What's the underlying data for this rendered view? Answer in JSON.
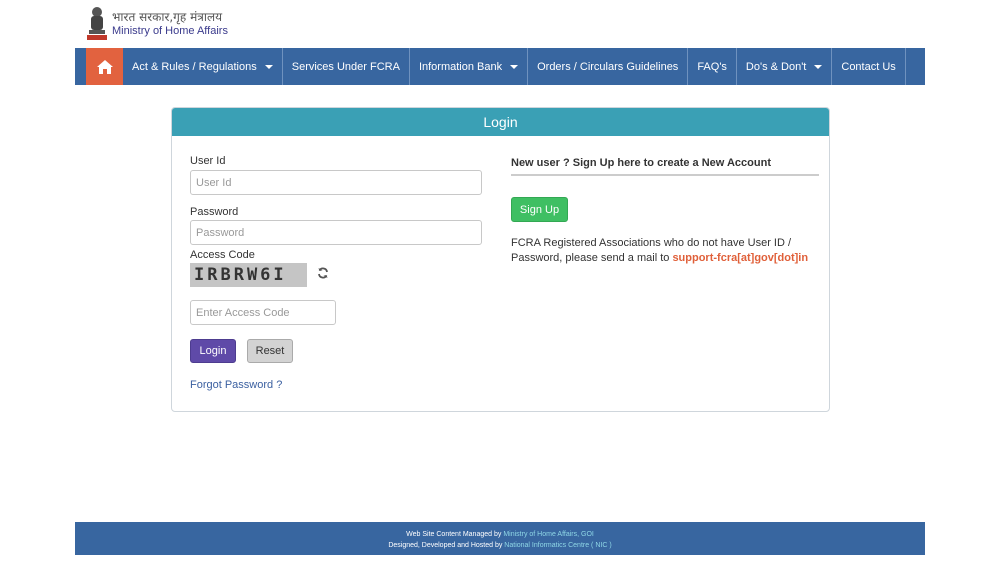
{
  "header": {
    "hindi": "भारत सरकार,गृह मंत्रालय",
    "english": "Ministry of Home Affairs"
  },
  "nav": {
    "items": [
      {
        "label": "Act & Rules / Regulations",
        "dropdown": true
      },
      {
        "label": "Services Under FCRA",
        "dropdown": false
      },
      {
        "label": "Information Bank",
        "dropdown": true
      },
      {
        "label": "Orders / Circulars Guidelines",
        "dropdown": false
      },
      {
        "label": "FAQ's",
        "dropdown": false
      },
      {
        "label": "Do's & Don't",
        "dropdown": true
      },
      {
        "label": "Contact Us",
        "dropdown": false
      }
    ]
  },
  "login": {
    "title": "Login",
    "user_id_label": "User Id",
    "user_id_placeholder": "User Id",
    "password_label": "Password",
    "password_placeholder": "Password",
    "access_code_label": "Access Code",
    "captcha_text": "IRBRW6I",
    "access_code_placeholder": "Enter Access Code",
    "login_button": "Login",
    "reset_button": "Reset",
    "forgot_password": "Forgot Password ?"
  },
  "signup": {
    "heading": "New user ? Sign Up here to create a New Account",
    "button": "Sign Up",
    "note": "FCRA Registered Associations who do not have User ID / Password, please send a mail to",
    "email": "support-fcra[at]gov[dot]in"
  },
  "footer": {
    "line1_prefix": "Web Site Content Managed by",
    "line1_link": "Ministry of Home Affairs, GOI",
    "line2_prefix": "Designed, Developed and Hosted by",
    "line2_link": "National Informatics Centre ( NIC )"
  },
  "colors": {
    "nav_bg": "#3866a0",
    "home_bg": "#e2623f",
    "login_header": "#3aa0b5",
    "login_button": "#5f4aa8",
    "signup_button": "#3fbf63",
    "email_color": "#e0603a"
  }
}
